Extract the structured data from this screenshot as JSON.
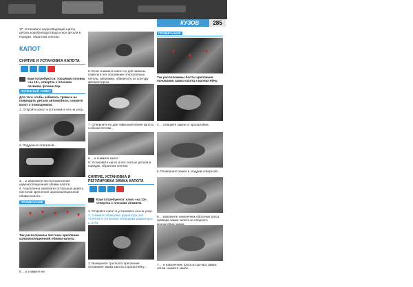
{
  "header": {
    "section": "КУЗОВ",
    "page_number": "285"
  },
  "col1": {
    "intro": "17. Установите водоотводящий щиток, деталь короба водоотвода и все детали в порядке, обратном снятию.",
    "title": "КАПОТ",
    "subtitle": "СНЯТИЕ И УСТАНОВКА КАПОТА",
    "needs": "Вам потребуются: торцевая головка «на 10», отвертка с плоским лезвием, фломастер.",
    "tip_title": "ПОЛЕЗНЫЙ СОВЕТ",
    "tip_text": "Для того чтобы избежать травм и не повредить детали автомобиля, снимите капот с помощником.",
    "step1": "1. Откройте капот и установите его на упор.",
    "step2": "2. Подденьте отверткой...",
    "step3": "3. ...и извлеките пистон крепления шумоизоляционной обивки капота.",
    "step4": "4. Аналогично извлеките остальные девять пистонов крепления шумоизоляционной обивки капота.",
    "note_title": "ПРИМЕЧАНИЕ",
    "note_text": "Так расположены пистоны крепления шумоизоляционной обивки капота.",
    "step5": "5. ...и снимите ее."
  },
  "col2": {
    "step6": "6. Если снимаете капот не для замены, пометьте его положение относительно петель, например, обведя его по контуру фломастером.",
    "step7": "7. Отверните по две гайки крепления капота к обеим петлям...",
    "step8": "8. ...и снимите капот.",
    "step9": "9. Установите капот и все снятые детали в порядке, обратном снятию.",
    "subtitle": "СНЯТИЕ, УСТАНОВКА И РЕГУЛИРОВКА ЗАМКА КАПОТА",
    "needs": "Вам потребуются: ключ «на 13», отвертка с плоским лезвием.",
    "step1": "1. Откройте капот и установите его на упор.",
    "step2": "2. Снимите облицовку радиатора (см. «Снятие и установка облицовки радиатора», с. 270).",
    "step3": "3. Выверните три болта крепления основания замка капота к кронштейну..."
  },
  "col3": {
    "note_title": "ПРИМЕЧАНИЕ",
    "note_text": "Так расположены болты крепления основания замка капота к кронштейну.",
    "step4": "4. ...отведите замок от кронштейна,",
    "step5": "5. Разверните замок и, поддев отверткой...",
    "step6": "6. ...извлеките наконечник оболочки троса привода замка капота из опорного кронштейна замка.",
    "step7": "7. ...и наконечник троса из рычага замка, затем снимите замок."
  }
}
